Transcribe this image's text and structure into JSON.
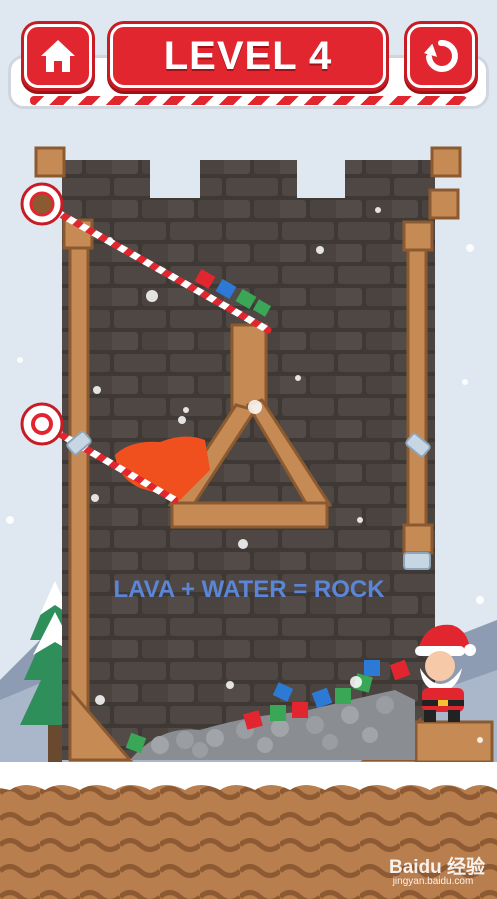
{
  "header": {
    "level_title": "LEVEL 4",
    "home_button": {
      "icon": "home-icon"
    },
    "restart_button": {
      "icon": "restart-icon"
    }
  },
  "hint_text": "LAVA + WATER = ROCK",
  "watermark": {
    "logo": "Baidu 经验",
    "url": "jingyan.baidu.com"
  },
  "colors": {
    "button_red": "#e2262f",
    "lava": "#f0501e",
    "stone_wall": "#4a4441",
    "wood": "#c68a55",
    "hint_blue": "#5b86d8",
    "ground": "#b97e4e"
  }
}
